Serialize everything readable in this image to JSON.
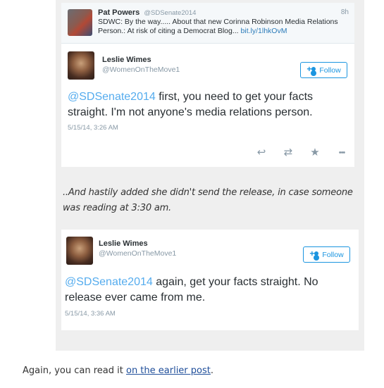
{
  "tweet1": {
    "reply_to": {
      "name": "Pat Powers",
      "handle": "@SDSenate2014",
      "time": "8h",
      "text_line1": "SDWC: By the way..... About that new Corinna Robinson Media Relations",
      "text_line2_prefix": "Person.: At risk of citing a Democrat Blog...",
      "link": "bit.ly/1lhkOvM"
    },
    "author": {
      "name": "Leslie Wimes",
      "handle": "@WomenOnTheMove1"
    },
    "follow_label": "Follow",
    "mention": "@SDSenate2014",
    "text_line1_rest": " first, you need to get your facts",
    "text_line2": "straight. I'm not anyone's media relations person.",
    "timestamp": "5/15/14, 3:26 AM",
    "actions": {
      "reply_glyph": "↩",
      "retweet_glyph": "⇄",
      "favorite_glyph": "★",
      "more_glyph": "•••"
    }
  },
  "narration": {
    "line1": "..And hastily added she didn't send the release, in case someone",
    "line2": "was reading at 3:30 am."
  },
  "tweet2": {
    "author": {
      "name": "Leslie Wimes",
      "handle": "@WomenOnTheMove1"
    },
    "follow_label": "Follow",
    "mention": "@SDSenate2014",
    "text_line1_rest": " again, get your facts straight. No",
    "text_line2": "release ever came from me.",
    "timestamp": "5/15/14, 3:36 AM"
  },
  "footer": {
    "prefix": "Again, you can read it ",
    "link": "on the earlier post",
    "suffix": "."
  },
  "colors": {
    "twitter_blue": "#55acee",
    "follow_blue": "#1b95e0",
    "muted_grey": "#8899a6",
    "panel_grey": "#efefef",
    "link_blue": "#1f4e9a"
  },
  "icons": [
    "follow-user-icon",
    "reply-icon",
    "retweet-icon",
    "favorite-icon",
    "more-icon"
  ]
}
